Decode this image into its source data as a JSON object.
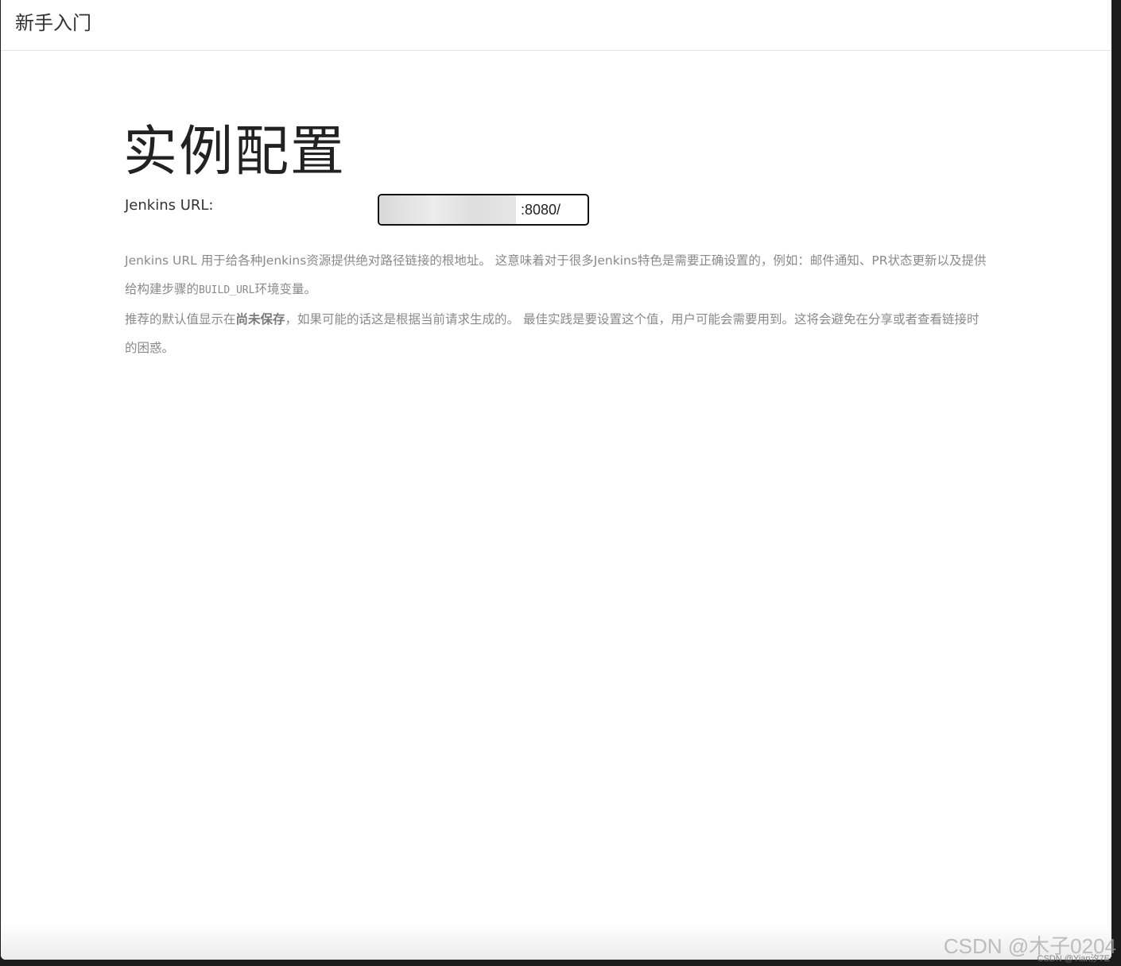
{
  "header": {
    "title": "新手入门"
  },
  "main": {
    "title": "实例配置",
    "url_label": "Jenkins URL:",
    "url_value": ":8080/",
    "help_p1_a": "Jenkins URL 用于给各种Jenkins资源提供绝对路径链接的根地址。 这意味着对于很多Jenkins特色是需要正确设置的，例如：邮件通知、PR状态更新以及提供给构建步骤的",
    "help_p1_code": "BUILD_URL",
    "help_p1_b": "环境变量。",
    "help_p2_a": "推荐的默认值显示在",
    "help_p2_bold": "尚未保存",
    "help_p2_b": "，如果可能的话这是根据当前请求生成的。 最佳实践是要设置这个值，用户可能会需要用到。这将会避免在分享或者查看链接时的困惑。"
  },
  "watermark": {
    "text": "CSDN @木子0204",
    "small": "CSDN @Yian汐7E"
  }
}
